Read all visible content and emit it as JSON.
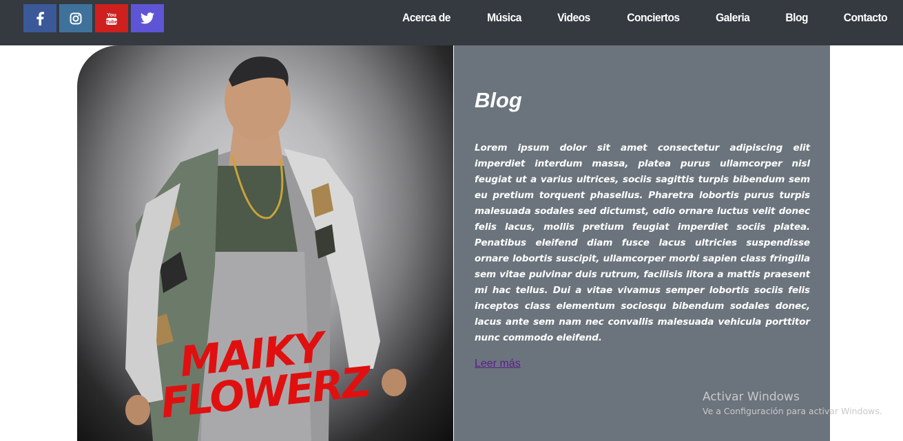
{
  "social": [
    {
      "name": "facebook",
      "icon": "facebook-icon",
      "bg": "#3b5998"
    },
    {
      "name": "instagram",
      "icon": "instagram-icon",
      "bg": "#3f729b"
    },
    {
      "name": "youtube",
      "icon": "youtube-icon",
      "bg": "#cd201f"
    },
    {
      "name": "twitter",
      "icon": "twitter-icon",
      "bg": "#5e55d6"
    }
  ],
  "nav": {
    "about": "Acerca de",
    "music": "Música",
    "videos": "Videos",
    "concerts": "Conciertos",
    "gallery": "Galeria",
    "blog": "Blog",
    "contact": "Contacto"
  },
  "hero": {
    "artist_logo_text": "Maiky Flowerz"
  },
  "blog": {
    "title": "Blog",
    "body": "Lorem ipsum dolor sit amet consectetur adipiscing elit imperdiet interdum massa, platea purus ullamcorper nisl feugiat ut a varius ultrices, sociis sagittis turpis bibendum sem eu pretium torquent phasellus. Pharetra lobortis purus turpis malesuada sodales sed dictumst, odio ornare luctus velit donec felis lacus, mollis pretium feugiat imperdiet sociis platea. Penatibus eleifend diam fusce lacus ultricies suspendisse ornare lobortis suscipit, ullamcorper morbi sapien class fringilla sem vitae pulvinar duis rutrum, facilisis litora a mattis praesent mi hac tellus. Dui a vitae vivamus semper lobortis sociis felis inceptos class elementum sociosqu bibendum sodales donec, lacus ante sem nam nec convallis malesuada vehicula porttitor nunc commodo eleifend.",
    "read_more": "Leer más"
  },
  "watermark": {
    "title": "Activar Windows",
    "subtitle": "Ve a Configuración para activar Windows."
  },
  "colors": {
    "navbar": "#343a40",
    "panel": "#6b747c",
    "link": "#5a1c8f",
    "logo_red": "#e01010"
  }
}
